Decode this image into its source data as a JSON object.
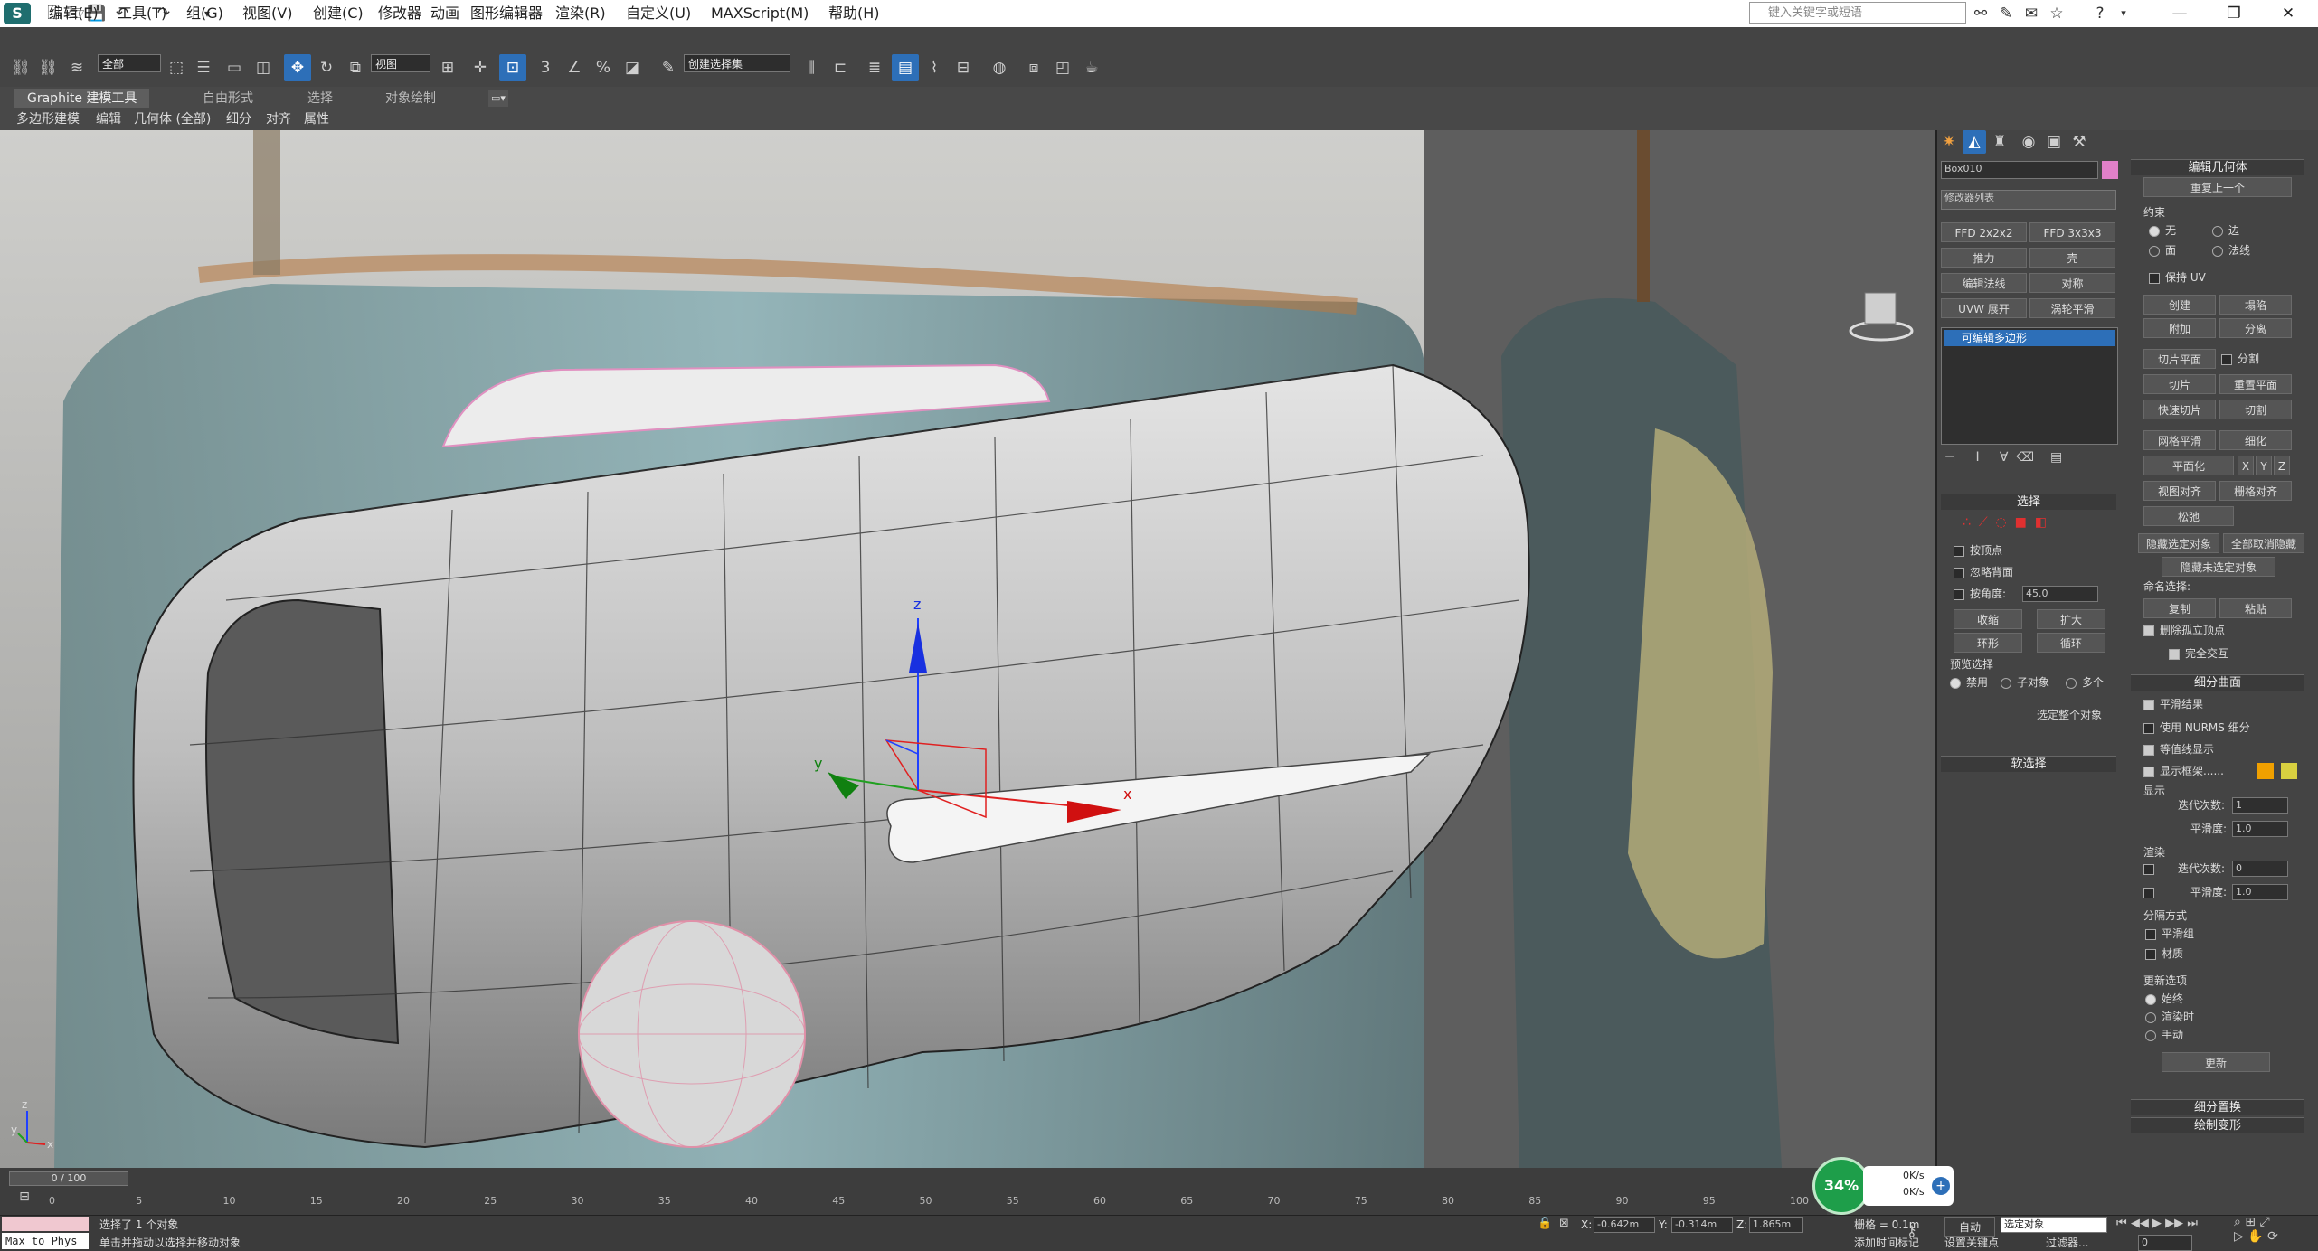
{
  "titlebar": {
    "menus": [
      "编辑(E)",
      "工具(T)",
      "组(G)",
      "视图(V)",
      "创建(C)",
      "修改器",
      "动画",
      "图形编辑器",
      "渲染(R)",
      "自定义(U)",
      "MAXScript(M)",
      "帮助(H)"
    ],
    "search_placeholder": "键入关键字或短语"
  },
  "toolbar": {
    "selection_filter": "全部",
    "ref_coord": "视图",
    "named_selection": "创建选择集"
  },
  "ribbon": {
    "tabs": [
      "Graphite 建模工具",
      "自由形式",
      "选择",
      "对象绘制"
    ],
    "subtabs": [
      "多边形建模",
      "编辑",
      "几何体 (全部)",
      "细分",
      "对齐",
      "属性"
    ]
  },
  "viewport": {
    "gizmo": {
      "x_label": "x",
      "y_label": "y",
      "z_label": "z"
    },
    "axis_tripod": {
      "x": "x",
      "y": "y",
      "z": "z"
    }
  },
  "cmdpanel": {
    "object_name": "Box010",
    "object_color": "#e080c8",
    "modifier_list": "修改器列表",
    "mod_buttons": [
      "FFD 2x2x2",
      "FFD 3x3x3",
      "推力",
      "壳",
      "编辑法线",
      "对称",
      "UVW 展开",
      "涡轮平滑"
    ],
    "stack_item": "可编辑多边形",
    "selection": {
      "title": "选择",
      "by_vertex": "按顶点",
      "ignore_backface": "忽略背面",
      "by_angle": "按角度:",
      "angle_value": "45.0",
      "shrink": "收缩",
      "grow": "扩大",
      "ring": "环形",
      "loop": "循环",
      "preview_title": "预览选择",
      "preview_opts": [
        "禁用",
        "子对象",
        "多个"
      ],
      "status": "选定整个对象"
    },
    "soft_selection": "软选择",
    "edit_geometry": {
      "title": "编辑几何体",
      "repeat_last": "重复上一个",
      "constraint_title": "约束",
      "constraints": [
        "无",
        "边",
        "面",
        "法线"
      ],
      "preserve_uv": "保持 UV",
      "create": "创建",
      "collapse": "塌陷",
      "attach": "附加",
      "detach": "分离",
      "slice_plane": "切片平面",
      "split": "分割",
      "slice": "切片",
      "reset_plane": "重置平面",
      "quickslice": "快速切片",
      "cut": "切割",
      "meshsmooth": "网格平滑",
      "tessellate": "细化",
      "planarize": "平面化",
      "x": "X",
      "y": "Y",
      "z": "Z",
      "view_align": "视图对齐",
      "grid_align": "栅格对齐",
      "relax": "松弛",
      "hide_sel": "隐藏选定对象",
      "unhide_all": "全部取消隐藏",
      "hide_unsel": "隐藏未选定对象",
      "named_sel": "命名选择:",
      "copy": "复制",
      "paste": "粘贴",
      "delete_iso": "删除孤立顶点",
      "full_interact": "完全交互"
    },
    "subdiv": {
      "title": "细分曲面",
      "smooth_result": "平滑结果",
      "use_nurms": "使用 NURMS 细分",
      "isoline": "等值线显示",
      "show_cage": "显示框架......",
      "cage_color1": "#f0a000",
      "cage_color2": "#d8d040",
      "display": "显示",
      "iterations": "迭代次数:",
      "iter_val": "1",
      "smoothness": "平滑度:",
      "smooth_val": "1.0",
      "render": "渲染",
      "r_iter_val": "0",
      "r_smooth_val": "1.0",
      "sep_title": "分隔方式",
      "smoothing_groups": "平滑组",
      "materials": "材质",
      "update_title": "更新选项",
      "update_opts": [
        "始终",
        "渲染时",
        "手动"
      ],
      "update_btn": "更新"
    },
    "subdiv_disp": "细分置换",
    "paint_deform": "绘制变形"
  },
  "timeline": {
    "frame": "0 / 100",
    "ticks": [
      "0",
      "5",
      "10",
      "15",
      "20",
      "25",
      "30",
      "35",
      "40",
      "45",
      "50",
      "55",
      "60",
      "65",
      "70",
      "75",
      "80",
      "85",
      "90",
      "95",
      "100"
    ]
  },
  "status": {
    "selected": "选择了 1 个对象",
    "prompt": "单击并拖动以选择并移动对象",
    "maxtophys": "Max to Phys",
    "x_val": "-0.642m",
    "y_val": "-0.314m",
    "z_val": "1.865m",
    "grid": "栅格 = 0.1m",
    "auto_key": "自动",
    "set_key": "设置关键点",
    "sel_set": "选定对象",
    "add_time_tag": "添加时间标记",
    "filters": "过滤器...",
    "frame_val": "0",
    "perf_pct": "34%",
    "net_up": "0K/s",
    "net_down": "0K/s"
  }
}
